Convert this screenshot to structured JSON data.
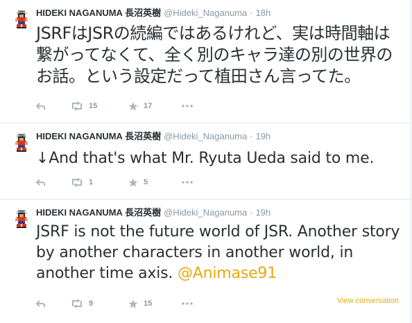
{
  "tweets": [
    {
      "fullname": "HIDEKI NAGANUMA 長沼英樹",
      "username": "@Hideki_Naganuma",
      "separator": "·",
      "time": "18h",
      "text": "JSRFはJSRの続編ではあるけれど、実は時間軸は繋がってなくて、全く別のキャラ達の別の世界のお話。という設定だって植田さん言ってた。",
      "retweets": "15",
      "favorites": "17"
    },
    {
      "fullname": "HIDEKI NAGANUMA 長沼英樹",
      "username": "@Hideki_Naganuma",
      "separator": "·",
      "time": "19h",
      "text": "↓And that's what Mr. Ryuta Ueda said to me.",
      "retweets": "1",
      "favorites": "5"
    },
    {
      "fullname": "HIDEKI NAGANUMA 長沼英樹",
      "username": "@Hideki_Naganuma",
      "separator": "·",
      "time": "19h",
      "text": "JSRF is not the future world of JSR. Another story by another characters in another world, in another time axis.",
      "mention": "@Animase91",
      "retweets": "9",
      "favorites": "15",
      "view_conversation": "View conversation"
    }
  ],
  "icons": {
    "reply": "reply-icon",
    "retweet": "retweet-icon",
    "favorite": "star-icon",
    "more": "more-dots-icon",
    "avatar": "avatar-pixel-character"
  },
  "colors": {
    "text": "#292f33",
    "muted": "#8899a6",
    "link": "#e8a90c",
    "border": "#e1e8ed"
  }
}
